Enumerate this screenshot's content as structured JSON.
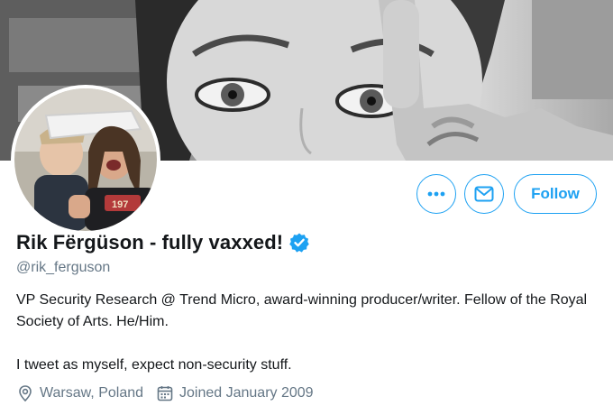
{
  "profile": {
    "name": "Rik Fërgüson - fully vaxxed!",
    "handle": "@rik_ferguson",
    "bio_line1": "VP Security Research @ Trend Micro, award-winning producer/writer. Fellow of the Royal Society of Arts. He/Him.",
    "bio_line2": "I tweet as myself, expect non-security stuff.",
    "location": "Warsaw, Poland",
    "joined": "Joined January 2009",
    "shirt_text": "197"
  },
  "actions": {
    "follow_label": "Follow"
  },
  "icons": {
    "more": "more-icon",
    "message": "envelope-icon",
    "verified": "verified-badge-icon",
    "location": "location-pin-icon",
    "calendar": "calendar-icon"
  },
  "colors": {
    "accent": "#1da1f2",
    "secondary_text": "#657786",
    "primary_text": "#14171a"
  }
}
